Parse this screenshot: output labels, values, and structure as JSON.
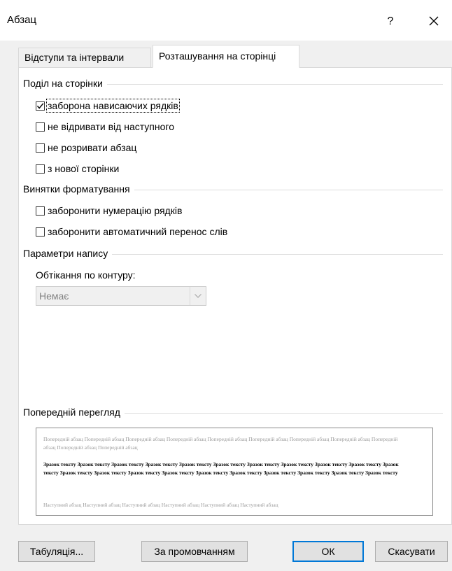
{
  "window": {
    "title": "Абзац",
    "help_label": "?",
    "close_icon": "close-icon"
  },
  "tabs": [
    {
      "label": "Відступи та інтервали",
      "active": false
    },
    {
      "label": "Розташування на сторінці",
      "active": true
    }
  ],
  "pagination": {
    "title": "Поділ на сторінки",
    "options": [
      {
        "label": "заборона нависаючих рядків",
        "checked": true
      },
      {
        "label": "не відривати від наступного",
        "checked": false
      },
      {
        "label": "не розривати абзац",
        "checked": false
      },
      {
        "label": "з нової сторінки",
        "checked": false
      }
    ]
  },
  "formatting_exceptions": {
    "title": "Винятки форматування",
    "options": [
      {
        "label": "заборонити нумерацію рядків",
        "checked": false
      },
      {
        "label": "заборонити автоматичний перенос слів",
        "checked": false
      }
    ]
  },
  "textbox_options": {
    "title": "Параметри напису",
    "wrap_label": "Обтікання по контуру:",
    "wrap_value": "Немає"
  },
  "preview": {
    "title": "Попередній перегляд",
    "previous_text": "Попередній абзац Попередній абзац Попередній абзац Попередній абзац Попередній абзац Попередній абзац Попередній абзац Попередній абзац Попередній абзац Попередній абзац Попередній абзац",
    "sample_text": "Зразок тексту Зразок тексту Зразок тексту Зразок тексту Зразок тексту Зразок тексту Зразок тексту Зразок тексту Зразок тексту Зразок тексту Зразок тексту Зразок тексту Зразок тексту Зразок тексту Зразок тексту Зразок тексту Зразок тексту Зразок тексту Зразок тексту Зразок тексту Зразок тексту",
    "next_text": "Наступний абзац Наступний абзац Наступний абзац Наступний абзац Наступний абзац Наступний абзац"
  },
  "buttons": {
    "tabs": "Табуляція...",
    "default": "За промовчанням",
    "ok": "ОК",
    "cancel": "Скасувати"
  },
  "colors": {
    "accent": "#0078d7",
    "disabled_text": "#838383"
  }
}
